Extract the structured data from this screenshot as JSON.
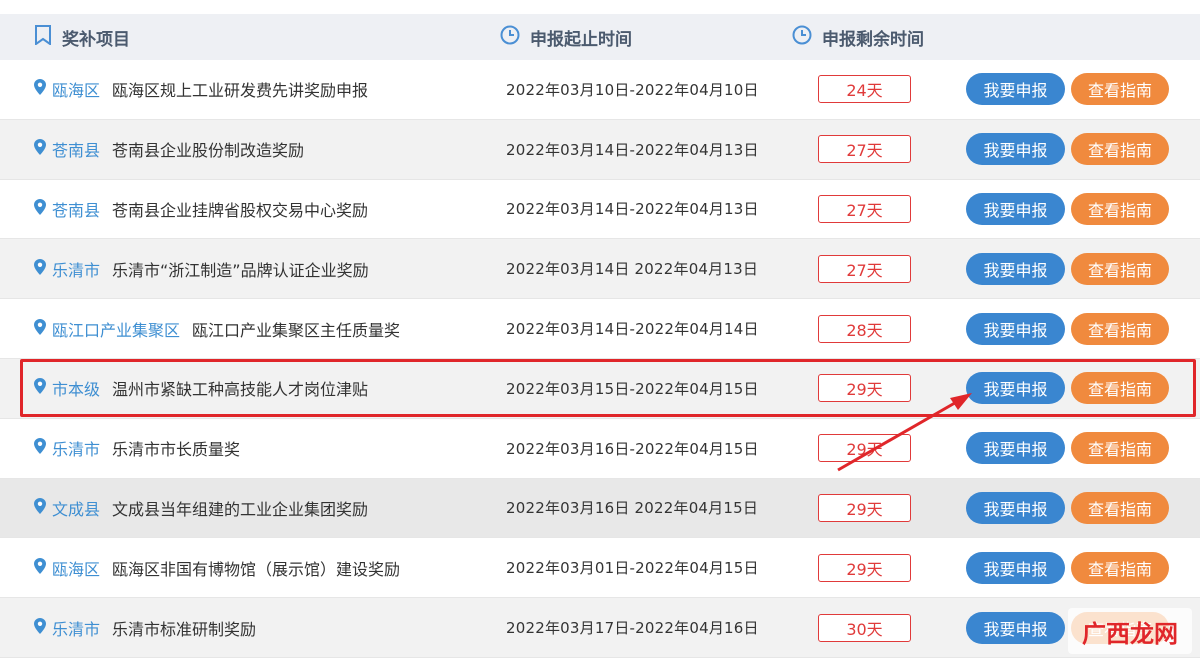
{
  "header": {
    "project_label": "奖补项目",
    "time_label": "申报起止时间",
    "remaining_label": "申报剩余时间"
  },
  "buttons": {
    "apply_label": "我要申报",
    "guide_label": "查看指南"
  },
  "rows": [
    {
      "region": "瓯海区",
      "title": "瓯海区规上工业研发费先讲奖励申报",
      "dates": "2022年03月10日-2022年04月10日",
      "days": "24天"
    },
    {
      "region": "苍南县",
      "title": "苍南县企业股份制改造奖励",
      "dates": "2022年03月14日-2022年04月13日",
      "days": "27天"
    },
    {
      "region": "苍南县",
      "title": "苍南县企业挂牌省股权交易中心奖励",
      "dates": "2022年03月14日-2022年04月13日",
      "days": "27天"
    },
    {
      "region": "乐清市",
      "title": "乐清市“浙江制造”品牌认证企业奖励",
      "dates": "2022年03月14日 2022年04月13日",
      "days": "27天"
    },
    {
      "region": "瓯江口产业集聚区",
      "title": "瓯江口产业集聚区主任质量奖",
      "dates": "2022年03月14日-2022年04月14日",
      "days": "28天"
    },
    {
      "region": "市本级",
      "title": "温州市紧缺工种高技能人才岗位津贴",
      "dates": "2022年03月15日-2022年04月15日",
      "days": "29天"
    },
    {
      "region": "乐清市",
      "title": "乐清市市长质量奖",
      "dates": "2022年03月16日-2022年04月15日",
      "days": "29天"
    },
    {
      "region": "文成县",
      "title": "文成县当年组建的工业企业集团奖励",
      "dates": "2022年03月16日 2022年04月15日",
      "days": "29天"
    },
    {
      "region": "瓯海区",
      "title": "瓯海区非国有博物馆（展示馆）建设奖励",
      "dates": "2022年03月01日-2022年04月15日",
      "days": "29天"
    },
    {
      "region": "乐清市",
      "title": "乐清市标准研制奖励",
      "dates": "2022年03月17日-2022年04月16日",
      "days": "30天"
    }
  ],
  "watermark": "广西龙网",
  "colors": {
    "region": "#3f8fd2",
    "days_border": "#e03a3a",
    "apply_button": "#3a86d0",
    "guide_button": "#f08a3e",
    "highlight": "#e0262a"
  }
}
